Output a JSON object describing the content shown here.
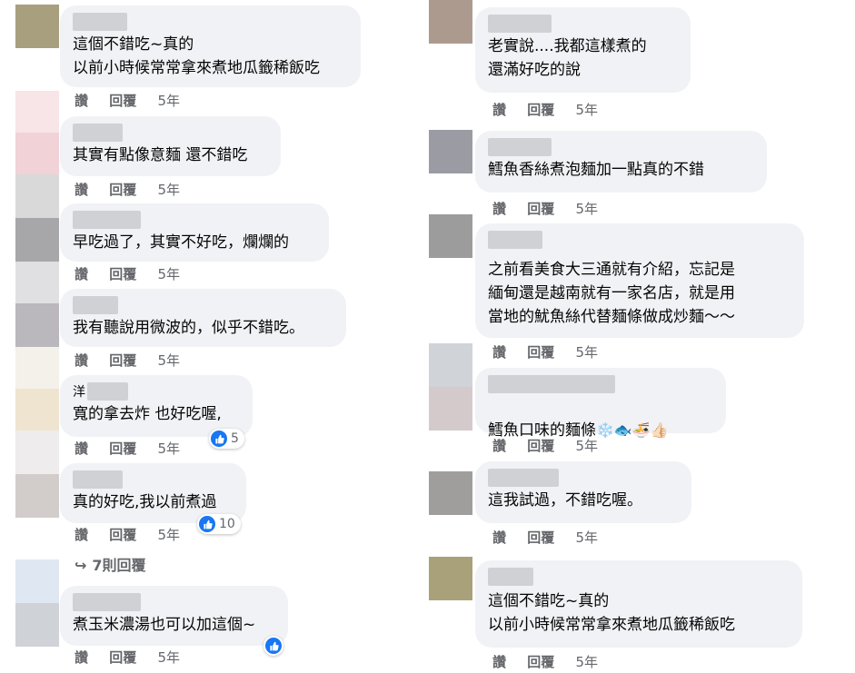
{
  "colors": {
    "bubble": "#f0f2f5",
    "secondary_text": "#65676b",
    "like_blue": "#1877f2"
  },
  "actions": {
    "like": "讚",
    "reply": "回覆"
  },
  "left_comments": [
    {
      "text": "這個不錯吃~真的\n以前小時候常常拿來煮地瓜籤稀飯吃",
      "time": "5年"
    },
    {
      "text": "其實有點像意麵 還不錯吃",
      "time": "5年"
    },
    {
      "text": "早吃過了，其實不好吃，爛爛的",
      "time": "5年"
    },
    {
      "text": "我有聽說用微波的，似乎不錯吃。",
      "time": "5年"
    },
    {
      "name_partial": "洋",
      "text": "寬的拿去炸 也好吃喔,",
      "time": "5年",
      "reactions": "5"
    },
    {
      "text": "真的好吃,我以前煮過",
      "time": "5年",
      "reactions": "10"
    },
    {
      "text": "煮玉米濃湯也可以加這個~",
      "time": "5年"
    }
  ],
  "view_replies": "7則回覆",
  "right_comments": [
    {
      "text": "老實說....我都這樣煮的\n還滿好吃的說",
      "time": "5年"
    },
    {
      "text": "鱈魚香絲煮泡麵加一點真的不錯",
      "time": "5年"
    },
    {
      "text": "之前看美食大三通就有介紹，忘記是\n緬甸還是越南就有一家名店，就是用\n當地的魷魚絲代替麵條做成炒麵～～",
      "time": "5年"
    },
    {
      "text": "鱈魚口味的麵條",
      "emojis": "❄️🐟🍜👍🏻",
      "time": "5年"
    },
    {
      "text": "這我試過，不錯吃喔。",
      "time": "5年"
    },
    {
      "text": "這個不錯吃~真的\n以前小時候常常拿來煮地瓜籤稀飯吃",
      "time": "5年"
    }
  ]
}
